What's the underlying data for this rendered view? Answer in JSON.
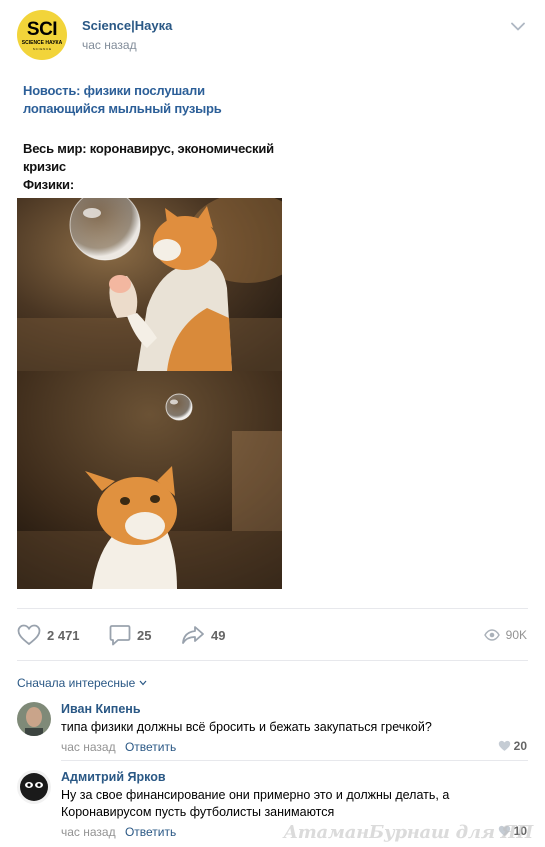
{
  "post": {
    "author": "Science|Наука",
    "time": "час назад",
    "logo": {
      "line1": "SCI",
      "line2": "SCIENCE НАУКА",
      "line3": "S C I E N C E"
    },
    "meme": {
      "news": "Новость: физики послушали лопающийся мыльный пузырь",
      "world": "Весь мир: коронавирус, экономический кризис",
      "physicists": "Физики:"
    }
  },
  "actions": {
    "likes": "2 471",
    "comments": "25",
    "shares": "49",
    "views": "90K"
  },
  "comments_section": {
    "sort_label": "Сначала интересные",
    "items": [
      {
        "author": "Иван Кипень",
        "text": "типа физики должны всё бросить и бежать закупаться гречкой?",
        "time": "час назад",
        "reply": "Ответить",
        "likes": "20"
      },
      {
        "author": "Адмитрий Ярков",
        "text": "Ну за свое финансирование они примерно это и должны делать, а Коронавирусом пусть футболисты занимаются",
        "time": "час назад",
        "reply": "Ответить",
        "likes": "10"
      }
    ]
  },
  "watermark": "АтаманБурнаш для ЯП",
  "colors": {
    "link": "#2a5885",
    "meta": "#818c99",
    "logo_bg": "#f2d43a"
  }
}
